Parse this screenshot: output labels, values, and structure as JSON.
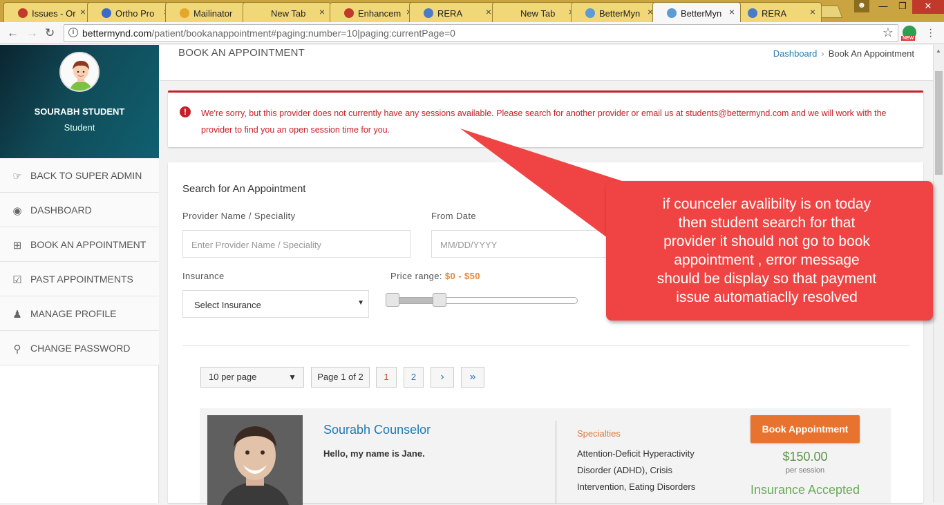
{
  "browser": {
    "tabs": [
      {
        "label": "Issues - Or",
        "color": "#c0392b",
        "active": false
      },
      {
        "label": "Ortho Pro",
        "color": "#3b6bc7",
        "active": false
      },
      {
        "label": "Mailinator",
        "color": "#e5a72a",
        "active": false
      },
      {
        "label": "New Tab",
        "color": "",
        "active": false
      },
      {
        "label": "Enhancem",
        "color": "#c0392b",
        "active": false
      },
      {
        "label": "RERA",
        "color": "#4a7bc7",
        "active": false
      },
      {
        "label": "New Tab",
        "color": "",
        "active": false
      },
      {
        "label": "BetterMyn",
        "color": "#5c9bd6",
        "active": false
      },
      {
        "label": "BetterMyn",
        "color": "#5c9bd6",
        "active": true
      },
      {
        "label": "RERA",
        "color": "#4a7bc7",
        "active": false
      }
    ],
    "url_host": "bettermynd.com",
    "url_path": "/patient/bookanappointment#paging:number=10|paging:currentPage=0",
    "ext_badge": "NEW"
  },
  "sidebar": {
    "user_name": "SOURABH STUDENT",
    "user_role": "Student",
    "items": [
      {
        "label": "BACK TO SUPER ADMIN",
        "icon": "back-hand-icon"
      },
      {
        "label": "DASHBOARD",
        "icon": "dashboard-gauge-icon"
      },
      {
        "label": "BOOK AN APPOINTMENT",
        "icon": "calendar-plus-icon"
      },
      {
        "label": "PAST APPOINTMENTS",
        "icon": "calendar-check-icon"
      },
      {
        "label": "MANAGE PROFILE",
        "icon": "user-icon"
      },
      {
        "label": "CHANGE PASSWORD",
        "icon": "key-icon"
      }
    ]
  },
  "header": {
    "title": "BOOK AN APPOINTMENT",
    "breadcrumb_home": "Dashboard",
    "breadcrumb_current": "Book An Appointment"
  },
  "alert": {
    "message": "We're sorry, but this provider does not currently have any sessions available. Please search for another provider or email us at students@bettermynd.com and we will work with the provider to find you an open session time for you.",
    "color": "#c81e28"
  },
  "search": {
    "title": "Search for An Appointment",
    "provider_label": "Provider Name / Speciality",
    "provider_placeholder": "Enter Provider Name / Speciality",
    "from_date_label": "From Date",
    "from_date_placeholder": "MM/DD/YYYY",
    "insurance_label": "Insurance",
    "insurance_value": "Select Insurance",
    "price_label": "Price range:",
    "price_value": "$0 - $50",
    "price_min_fraction": 0.0,
    "price_max_fraction": 0.25
  },
  "pagination": {
    "per_page": "10 per page",
    "page_info": "Page 1 of 2",
    "pages": [
      "1",
      "2"
    ],
    "next": "›",
    "last": "»"
  },
  "provider": {
    "name": "Sourabh Counselor",
    "intro": "Hello, my name is Jane.",
    "specialties_title": "Specialties",
    "specialties": "Attention-Deficit Hyperactivity Disorder (ADHD), Crisis Intervention, Eating Disorders",
    "book_label": "Book Appointment",
    "price": "$150.00",
    "per_session": "per session",
    "insurance": "Insurance Accepted"
  },
  "annotation": {
    "text": "if counceler avalibilty is on today\nthen  student search for that\nprovider  it should not  go to book\nappointment , error message\nshould be display so that  payment\nissue automatiaclly resolved",
    "color": "#f04444"
  }
}
